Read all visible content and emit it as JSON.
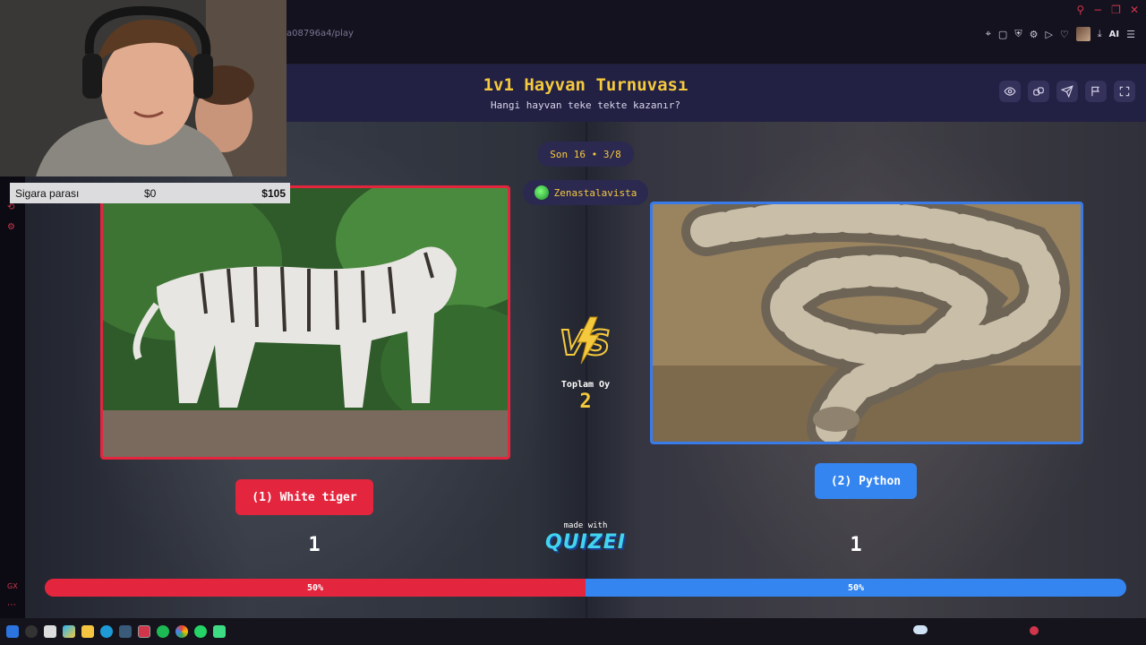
{
  "browser": {
    "url_fragment": "a08796a4/play",
    "window_buttons": [
      "⚲",
      "−",
      "❐",
      "✕"
    ],
    "toolbar_ai_label": "AI"
  },
  "quiz": {
    "title": "1v1 Hayvan Turnuvası",
    "subtitle": "Hangi hayvan teke tekte kazanır?",
    "header_buttons": [
      "eye-icon",
      "link-icon",
      "send-icon",
      "flag-icon",
      "fullscreen-icon"
    ],
    "round_label": "Son 16 • 3/8",
    "username": "Zenastalavista",
    "vs_label": "VS",
    "total_votes_label": "Toplam Oy",
    "total_votes": "2",
    "left": {
      "label": "(1) White tiger",
      "score": "1",
      "percent_label": "50%",
      "percent": 50,
      "color": "#e3263e"
    },
    "right": {
      "label": "(2) Python",
      "score": "1",
      "percent_label": "50%",
      "percent": 50,
      "color": "#3485f0"
    },
    "made_with": "made with",
    "brand": "QUIZEI"
  },
  "overlay": {
    "donation_label": "Sigara parası",
    "donation_current": "$0",
    "donation_goal": "$105"
  }
}
